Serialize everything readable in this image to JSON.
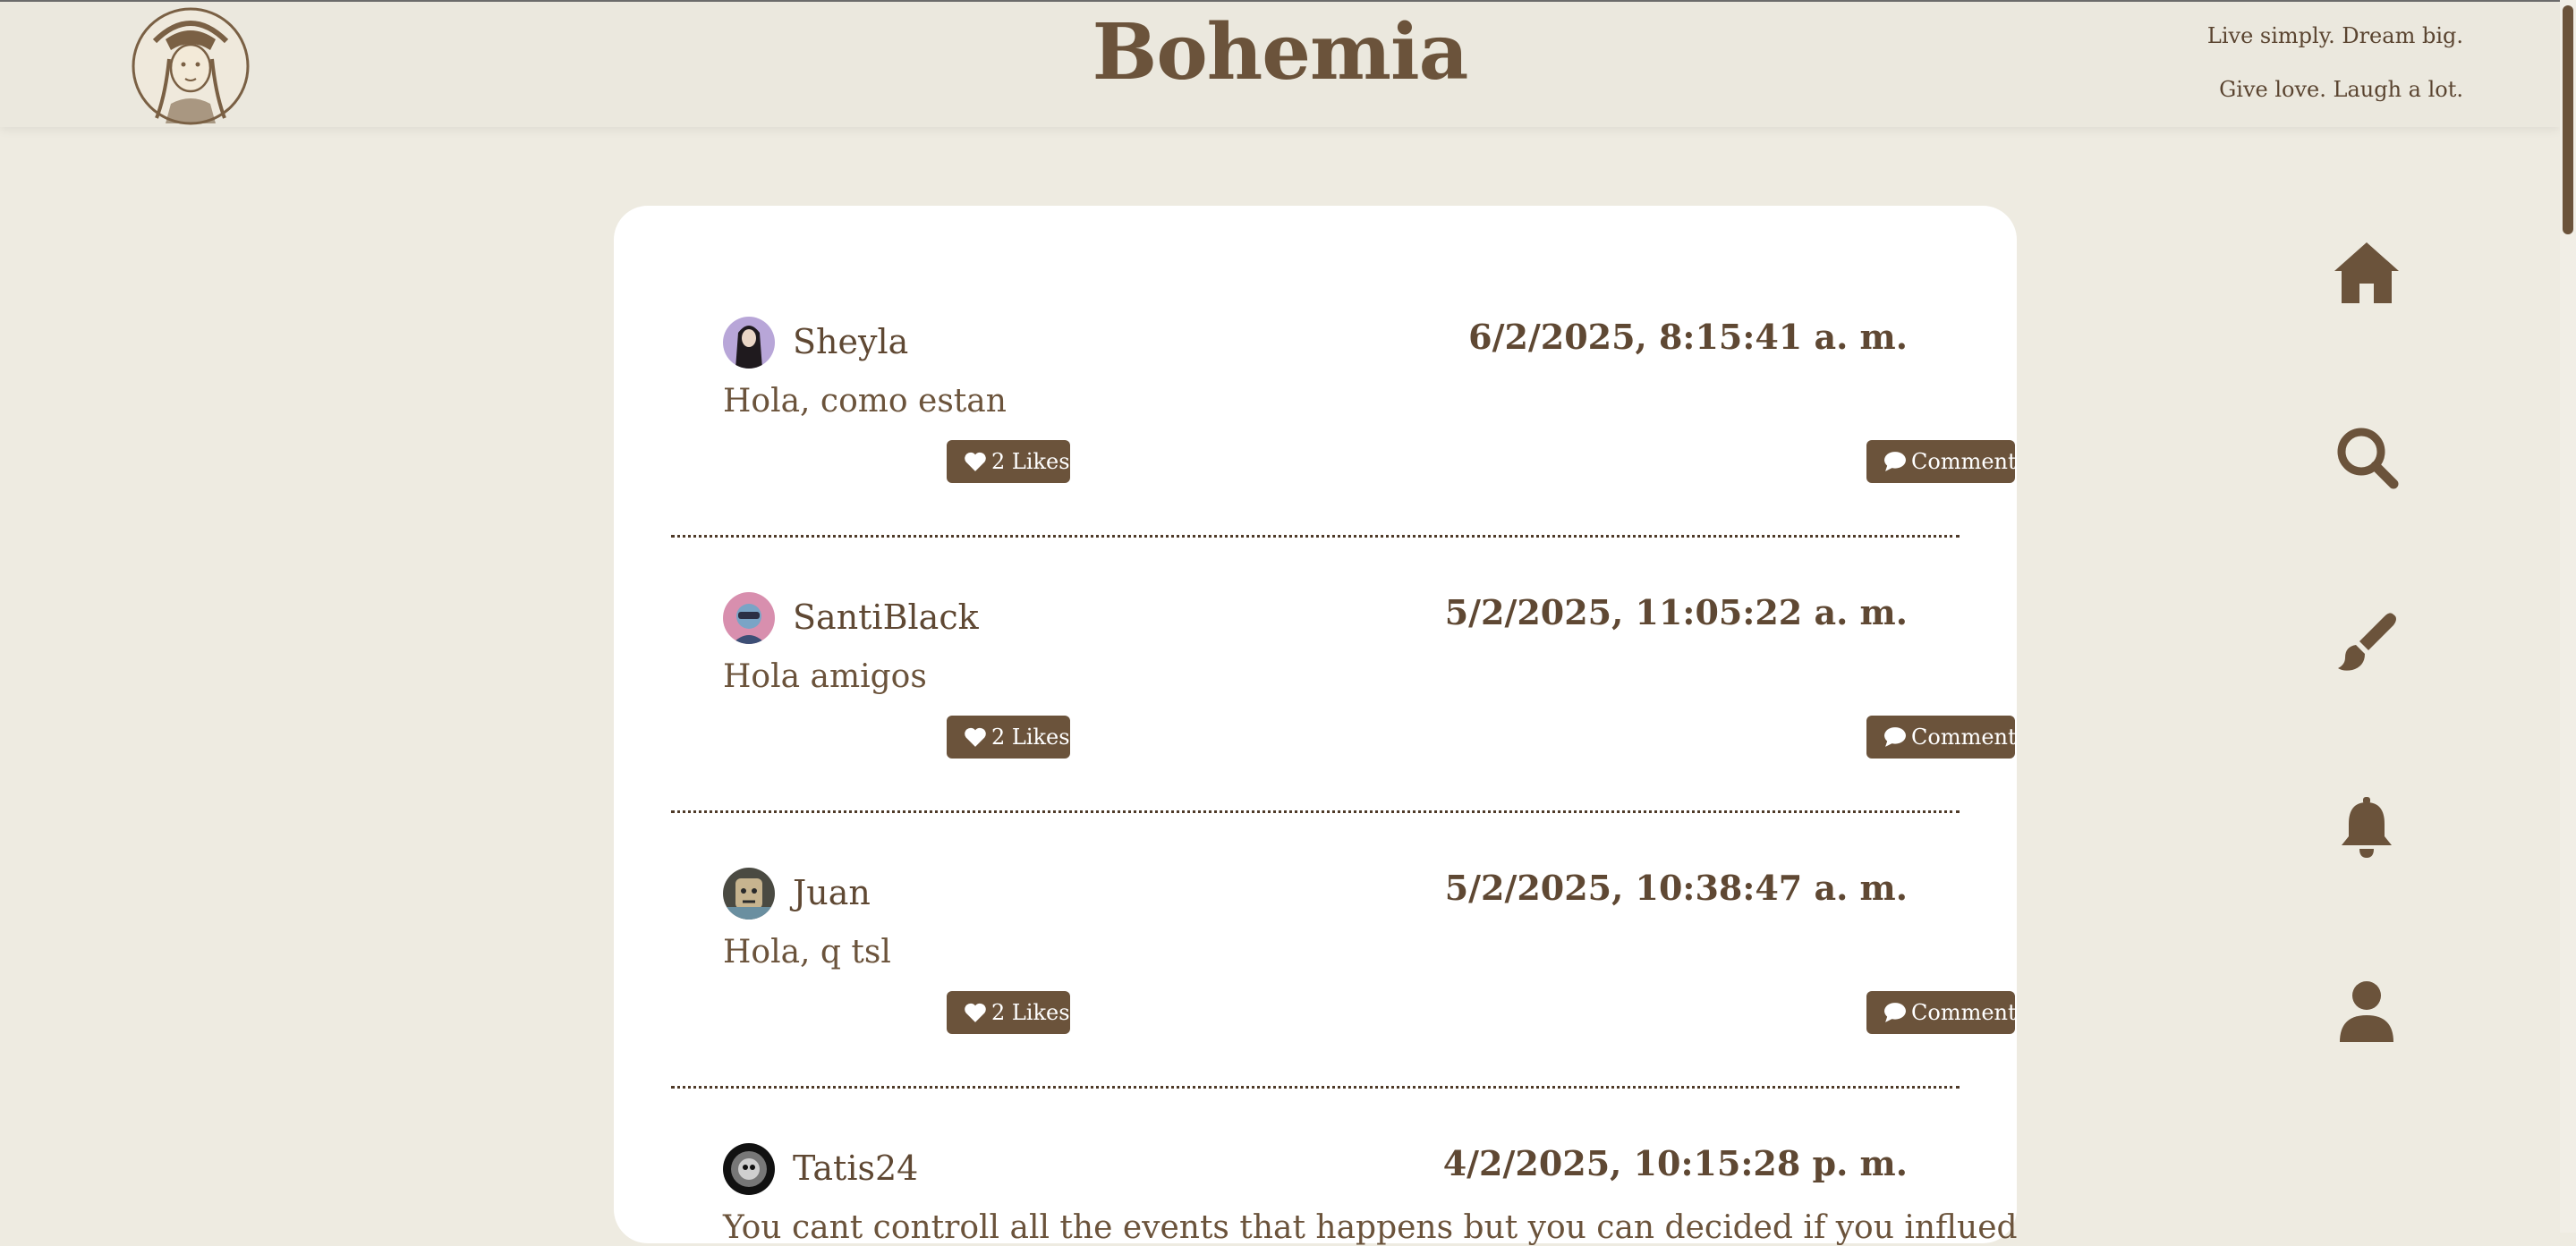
{
  "header": {
    "brand": "Bohemia",
    "taglines": [
      "Live simply. Dream big.",
      "Give love. Laugh a lot."
    ]
  },
  "colors": {
    "accent": "#6b533b",
    "background": "#eeebe1",
    "card": "#ffffff"
  },
  "posts": [
    {
      "user": "Sheyla",
      "timestamp": "6/2/2025, 8:15:41 a. m.",
      "content": "Hola, como estan",
      "likes_label": "2 Likes",
      "comment_label": "Comment"
    },
    {
      "user": "SantiBlack",
      "timestamp": "5/2/2025, 11:05:22 a. m.",
      "content": "Hola amigos",
      "likes_label": "2 Likes",
      "comment_label": "Comment"
    },
    {
      "user": "Juan",
      "timestamp": "5/2/2025, 10:38:47 a. m.",
      "content": "Hola, q tsl",
      "likes_label": "2 Likes",
      "comment_label": "Comment"
    },
    {
      "user": "Tatis24",
      "timestamp": "4/2/2025, 10:15:28 p. m.",
      "content": "You cant controll all the events that happens but you can decided if you influed"
    }
  ],
  "nav": [
    "home-icon",
    "search-icon",
    "paintbrush-icon",
    "bell-icon",
    "user-icon"
  ]
}
